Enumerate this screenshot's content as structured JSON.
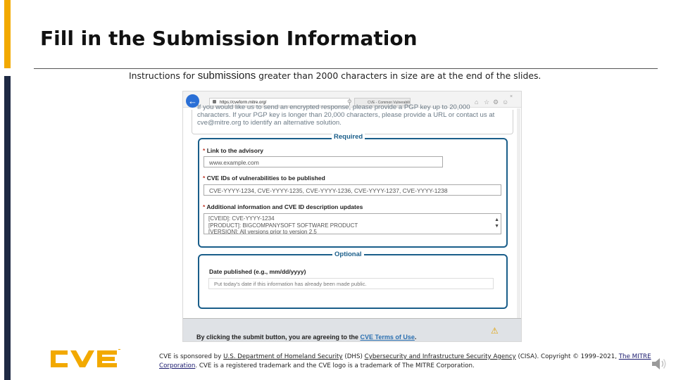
{
  "slide": {
    "title": "Fill in the Submission Information",
    "instructions_pre": "Instructions for ",
    "instructions_word": "submissions",
    "instructions_post": " greater than 2000 characters in size are at the end of the slides.",
    "accent_colors": {
      "yellow": "#f2a900",
      "navy": "#1f2a44"
    }
  },
  "browser": {
    "url": "https://cveform.mitre.org/",
    "tab_label": "CVE - Common Vulnerabilities",
    "icons": [
      "back-arrow-icon",
      "lock-icon",
      "search-icon",
      "refresh-icon",
      "home-icon",
      "star-icon",
      "gear-icon",
      "smiley-icon"
    ]
  },
  "form": {
    "gpg_text": "If you would like us to send an encrypted response, please provide a PGP key up to 20,000\ncharacters. If your PGP key is longer than 20,000 characters, please provide a URL or contact us at\ncve@mitre.org to identify an alternative solution.",
    "required_legend": "Required",
    "optional_legend": "Optional",
    "advisory_label": "Link to the advisory",
    "advisory_value": "www.example.com",
    "cve_ids_label": "CVE IDs of vulnerabilities to be published",
    "cve_ids_value": "CVE-YYYY-1234, CVE-YYYY-1235, CVE-YYYY-1236, CVE-YYYY-1237, CVE-YYYY-1238",
    "additional_label": "Additional information and CVE ID description updates",
    "additional_value": "[CVEID]: CVE-YYYY-1234\n[PRODUCT]: BIGCOMPANYSOFT SOFTWARE PRODUCT\n[VERSION]: All versions prior to version 2.5",
    "date_label": "Date published (e.g., mm/dd/yyyy)",
    "date_placeholder": "Put today's date if this information has already been made public.",
    "required_star": "*",
    "notice_pre": "By clicking the submit button, you are agreeing to the ",
    "notice_link": "CVE Terms of Use",
    "notice_post": "."
  },
  "footer": {
    "logo_text": "CVE",
    "brand_color": "#f2a900",
    "text_1": "CVE is sponsored by ",
    "link_dhs": "U.S. Department of Homeland Security",
    "text_2": " (DHS) ",
    "link_cisa": "Cybersecurity and Infrastructure Security Agency",
    "text_3": " (CISA). Copyright © 1999–2021, ",
    "link_mitre": "The MITRE Corporation",
    "text_4": ". CVE is a registered trademark and the CVE logo is a trademark of The MITRE Corporation.",
    "speaker_icon": "speaker-icon"
  }
}
